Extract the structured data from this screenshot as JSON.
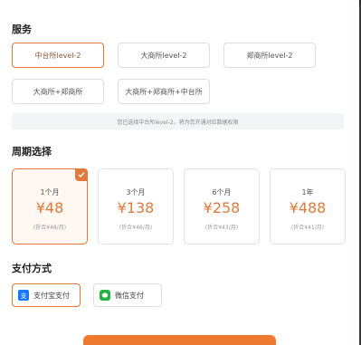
{
  "colors": {
    "accent": "#e07a3c",
    "wechat": "#27b144",
    "alipay": "#1677ff"
  },
  "services": {
    "title": "服务",
    "options": [
      {
        "label": "中台所level-2",
        "selected": true
      },
      {
        "label": "大商所level-2",
        "selected": false
      },
      {
        "label": "郑商所level-2",
        "selected": false
      },
      {
        "label": "大商所+郑商所",
        "selected": false
      },
      {
        "label": "大商所+郑商所+中台所",
        "selected": false
      }
    ],
    "notice": "您已选择中台所level-2，将为您开通对应数据权限"
  },
  "period": {
    "title": "周期选择",
    "plans": [
      {
        "duration": "1个月",
        "price": "¥48",
        "daily": "(折合¥48/月)",
        "selected": true
      },
      {
        "duration": "3个月",
        "price": "¥138",
        "daily": "(折合¥46/月)",
        "selected": false
      },
      {
        "duration": "6个月",
        "price": "¥258",
        "daily": "(折合¥43/月)",
        "selected": false
      },
      {
        "duration": "1年",
        "price": "¥488",
        "daily": "(折合¥41/月)",
        "selected": false
      }
    ]
  },
  "payment": {
    "title": "支付方式",
    "methods": [
      {
        "label": "支付宝支付",
        "icon": "alipay-icon",
        "selected": true
      },
      {
        "label": "微信支付",
        "icon": "wechat-icon",
        "selected": false
      }
    ]
  }
}
